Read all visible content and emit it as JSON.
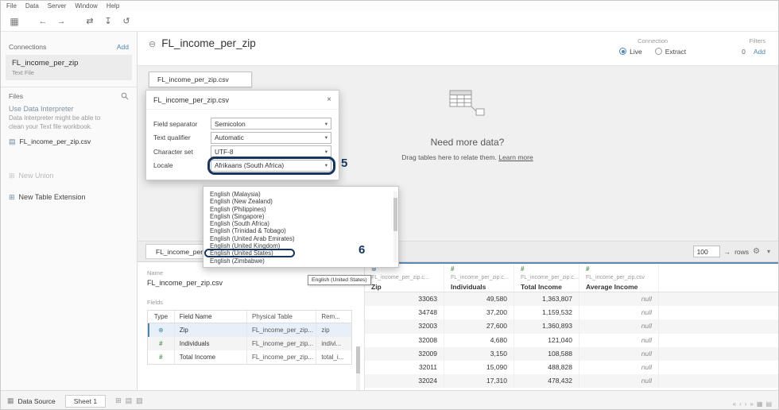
{
  "glyphs": {
    "logo": "▦",
    "back": "←",
    "forward": "→",
    "swap": "⇄",
    "save": "↧",
    "refresh": "↺",
    "close": "×",
    "caret": "▾",
    "gear": "⚙",
    "chevron_down": "▾",
    "arrow_right": "→",
    "globe": "⊕",
    "hash": "#",
    "text_file": "▤",
    "union": "⊞",
    "table_ext": "⊞",
    "datasource_circle": "⊖",
    "datasource_grid": "▦",
    "new_sheet": "⊞",
    "new_dashboard": "▤",
    "new_story": "▧",
    "nav_first": "«",
    "nav_prev": "‹",
    "nav_next": "›",
    "nav_last": "»",
    "view_grid": "▦",
    "view_tabs": "▤"
  },
  "menubar": [
    "File",
    "Data",
    "Server",
    "Window",
    "Help"
  ],
  "sidebar": {
    "connections_label": "Connections",
    "add_link": "Add",
    "connection": {
      "name": "FL_income_per_zip",
      "type": "Text File"
    },
    "files_label": "Files",
    "interpreter_link": "Use Data Interpreter",
    "interpreter_desc": "Data Interpreter might be able to clean your Text file workbook.",
    "file_name": "FL_income_per_zip.csv",
    "new_union": "New Union",
    "new_table_extension": "New Table Extension"
  },
  "header": {
    "title": "FL_income_per_zip",
    "connection_label": "Connection",
    "live": "Live",
    "extract": "Extract",
    "filters_label": "Filters",
    "filters_count": "0",
    "filters_add": "Add"
  },
  "canvas": {
    "table_chip": "FL_income_per_zip.csv",
    "need_more_title": "Need more data?",
    "drag_hint": "Drag tables here to relate them.",
    "learn_more": "Learn more"
  },
  "dialog": {
    "title": "FL_income_per_zip.csv",
    "rows": [
      {
        "label": "Field separator",
        "value": "Semicolon"
      },
      {
        "label": "Text qualifier",
        "value": "Automatic"
      },
      {
        "label": "Character set",
        "value": "UTF-8"
      },
      {
        "label": "Locale",
        "value": "Afrikaans (South Africa)",
        "highlighted": true
      }
    ]
  },
  "locale_dropdown": {
    "options": [
      "English (Malaysia)",
      "English (New Zealand)",
      "English (Philippines)",
      "English (Singapore)",
      "English (South Africa)",
      "English (Trinidad & Tobago)",
      "English (United Arab Emirates)",
      "English (United Kingdom)",
      "English (United States)",
      "English (Zimbabwe)"
    ],
    "highlighted_option": "English (United States)",
    "tooltip": "English (United States)"
  },
  "annotations": {
    "step5": "5",
    "step6": "6"
  },
  "bottom": {
    "tab_label": "FL_income_per_zip.",
    "rows_value": "100",
    "rows_label": "rows",
    "meta": {
      "name_label": "Name",
      "name_value": "FL_income_per_zip.csv",
      "fields_label": "Fields",
      "columns": [
        "Type",
        "Field Name",
        "Physical Table",
        "Rem..."
      ],
      "fields": [
        {
          "type": "globe",
          "name": "Zip",
          "physical_table": "FL_income_per_zip...",
          "remote": "zip"
        },
        {
          "type": "hash",
          "name": "Individuals",
          "physical_table": "FL_income_per_zip...",
          "remote": "indivi..."
        },
        {
          "type": "hash",
          "name": "Total Income",
          "physical_table": "FL_income_per_zip...",
          "remote": "total_i..."
        }
      ]
    }
  },
  "grid": {
    "columns": [
      {
        "icon": "globe",
        "source": "FL_income_per_zip.c...",
        "name": "Zip"
      },
      {
        "icon": "hash",
        "source": "FL_income_per_zip.c...",
        "name": "Individuals"
      },
      {
        "icon": "hash",
        "source": "FL_income_per_zip.c...",
        "name": "Total Income"
      },
      {
        "icon": "hash",
        "source": "FL_income_per_zip.csv",
        "name": "Average Income"
      }
    ],
    "rows": [
      [
        "33063",
        "49,580",
        "1,363,807",
        "null"
      ],
      [
        "34748",
        "37,200",
        "1,159,532",
        "null"
      ],
      [
        "32003",
        "27,600",
        "1,360,893",
        "null"
      ],
      [
        "32008",
        "4,680",
        "121,040",
        "null"
      ],
      [
        "32009",
        "3,150",
        "108,588",
        "null"
      ],
      [
        "32011",
        "15,090",
        "488,828",
        "null"
      ],
      [
        "32024",
        "17,310",
        "478,432",
        "null"
      ]
    ]
  },
  "statusbar": {
    "data_source_tab": "Data Source",
    "sheet_tab": "Sheet 1"
  },
  "colors": {
    "accent_blue": "#4f86b0",
    "annotation_navy": "#17355e",
    "hash_green": "#4e9150"
  }
}
